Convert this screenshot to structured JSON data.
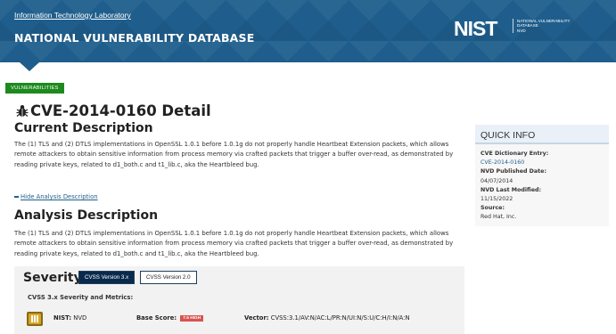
{
  "header": {
    "itl_link": "Information Technology Laboratory",
    "title": "NATIONAL VULNERABILITY DATABASE",
    "logo_text": "NIST",
    "logo_sub": [
      "NATIONAL VULNERABILITY",
      "DATABASE",
      "NVD"
    ]
  },
  "badge": "VULNERABILITIES",
  "cve": {
    "title": "CVE-2014-0160 Detail",
    "current_heading": "Current Description",
    "current_description": "The (1) TLS and (2) DTLS implementations in OpenSSL 1.0.1 before 1.0.1g do not properly handle Heartbeat Extension packets, which allows remote attackers to obtain sensitive information from process memory via crafted packets that trigger a buffer over-read, as demonstrated by reading private keys, related to d1_both.c and t1_lib.c, aka the Heartbleed bug.",
    "hide_link": "Hide Analysis Description",
    "analysis_heading": "Analysis Description",
    "analysis_description": "The (1) TLS and (2) DTLS implementations in OpenSSL 1.0.1 before 1.0.1g do not properly handle Heartbeat Extension packets, which allows remote attackers to obtain sensitive information from process memory via crafted packets that trigger a buffer over-read, as demonstrated by reading private keys, related to d1_both.c and t1_lib.c, aka the Heartbleed bug."
  },
  "severity": {
    "heading": "Severity",
    "tabs": [
      "CVSS Version 3.x",
      "CVSS Version 2.0"
    ],
    "metrics_heading": "CVSS 3.x Severity and Metrics:",
    "nist_label": "NIST:",
    "nist_value": "NVD",
    "base_score_label": "Base Score:",
    "base_score_value": "7.5 HIGH",
    "vector_label": "Vector:",
    "vector_value": "CVSS:3.1/AV:N/AC:L/PR:N/UI:N/S:U/C:H/I:N/A:N",
    "colors": {
      "high": "#d9534f",
      "tab_active": "#0a2a4d"
    }
  },
  "quick_info": {
    "title": "QUICK INFO",
    "dict_label": "CVE Dictionary Entry:",
    "dict_value": "CVE-2014-0160",
    "published_label": "NVD Published Date:",
    "published_value": "04/07/2014",
    "modified_label": "NVD Last Modified:",
    "modified_value": "11/15/2022",
    "source_label": "Source:",
    "source_value": "Red Hat, Inc."
  },
  "colors": {
    "header": "#1f5e8c",
    "badge": "#1e8a1e",
    "link": "#1f5e8c"
  },
  "icons": [
    "bug-icon",
    "nist-badge-icon",
    "minus-icon"
  ]
}
